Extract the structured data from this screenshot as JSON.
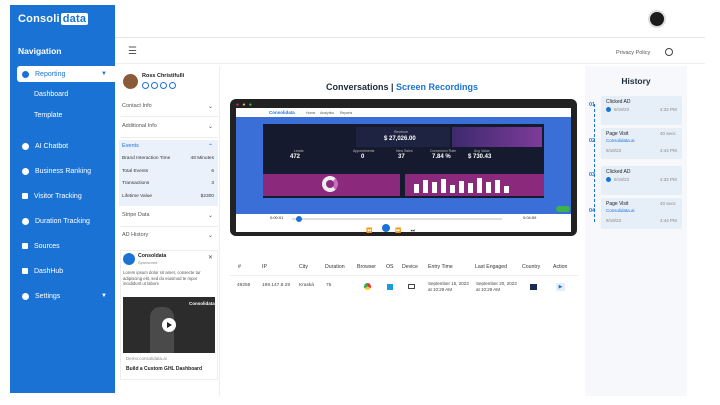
{
  "brand": {
    "logo_prefix": "Consoli",
    "logo_box": "data"
  },
  "sidebar": {
    "title": "Navigation",
    "items": [
      {
        "label": "Reporting",
        "icon": "pie-chart-icon",
        "active": true
      },
      {
        "label": "AI Chatbot",
        "icon": "chat-icon"
      },
      {
        "label": "Business Ranking",
        "icon": "location-icon"
      },
      {
        "label": "Visitor Tracking",
        "icon": "eye-icon"
      },
      {
        "label": "Duration Tracking",
        "icon": "clock-icon"
      },
      {
        "label": "Sources",
        "icon": "branch-icon"
      },
      {
        "label": "DashHub",
        "icon": "edit-icon"
      },
      {
        "label": "Settings",
        "icon": "gear-icon"
      }
    ],
    "sub_items": [
      "Dashboard",
      "Template"
    ]
  },
  "topbar": {
    "privacy": "Privacy Policy"
  },
  "contact": {
    "name": "Ross Christifulli",
    "sections": [
      "Contact Info",
      "Additional Info",
      "Events",
      "Stripe Data",
      "AD History"
    ],
    "events": [
      {
        "label": "Brand Interaction Time",
        "value": "48 Minutes"
      },
      {
        "label": "Total Events",
        "value": "6"
      },
      {
        "label": "Transactions",
        "value": "3"
      },
      {
        "label": "Lifetime Value",
        "value": "$2300"
      }
    ],
    "ad": {
      "brand": "Consoldata",
      "sponsored": "Sponsored",
      "text": "Lorem ipsum dolor sit amet, consecte tur adipiscing elit, sed do eiusmod te mpor incididunt ut labore",
      "video_brand": "Consolidata",
      "domain": "Demo.consolidata.ai",
      "title": "Build a Custom GHL Dashboard"
    }
  },
  "main": {
    "title_a": "Conversations | ",
    "title_b": "Screen Recordings",
    "video": {
      "t0": "0:00:01",
      "t1": "0:04:59"
    },
    "dashboard": {
      "logo": "Consolidata",
      "nav": [
        "Home",
        "Analytics",
        "Reports"
      ],
      "tiles": [
        {
          "label": "Revenue",
          "value": "$ 27,026.00"
        },
        {
          "label": "Leads",
          "value": "472"
        },
        {
          "label": "Appointments",
          "value": "0"
        },
        {
          "label": "New Sales",
          "value": "37"
        },
        {
          "label": "Conversion Rate",
          "value": "7.84 %"
        },
        {
          "label": "Avg Value",
          "value": "$ 730.43"
        }
      ]
    },
    "table": {
      "headers": [
        "#",
        "IP",
        "City",
        "Duration",
        "Browser",
        "OS",
        "Device",
        "Entry Time",
        "Last Engaged",
        "Country",
        "Action"
      ],
      "row": {
        "id": "49255",
        "ip": "199.147.8.29",
        "city": "Kraská",
        "duration": "75",
        "entry": "September 15, 2023 at 10:29 AM",
        "last": "September 20, 2023 at 10:29 AM"
      }
    }
  },
  "history": {
    "title": "History",
    "items": [
      {
        "num": "01",
        "title": "Clicked AD",
        "date": "9/18/23",
        "time": "4:32 PM",
        "extra": ""
      },
      {
        "num": "02",
        "title": "Page Visit",
        "date": "9/18/23",
        "time": "4:44 PM",
        "extra": "40 secs",
        "link": "Consolidata.ai"
      },
      {
        "num": "03",
        "title": "Clicked AD",
        "date": "9/18/23",
        "time": "4:32 PM",
        "extra": ""
      },
      {
        "num": "04",
        "title": "Page Visit",
        "date": "9/18/23",
        "time": "4:44 PM",
        "extra": "40 secs",
        "link": "Consolidata.ai"
      }
    ]
  }
}
